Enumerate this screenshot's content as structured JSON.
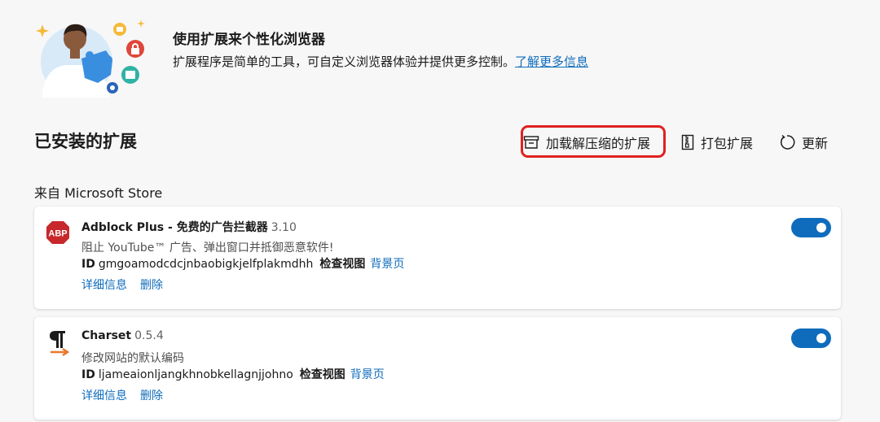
{
  "hero": {
    "title": "使用扩展来个性化浏览器",
    "description": "扩展程序是简单的工具，可自定义浏览器体验并提供更多控制。",
    "learn_more": "了解更多信息"
  },
  "section_title": "已安装的扩展",
  "toolbar": {
    "load_unpacked": "加载解压缩的扩展",
    "pack": "打包扩展",
    "update": "更新"
  },
  "store_label": "来自 Microsoft Store",
  "extensions": [
    {
      "name": "Adblock Plus - 免费的广告拦截器",
      "version": "3.10",
      "description": "阻止 YouTube™ 广告、弹出窗口并抵御恶意软件!",
      "id_label": "ID",
      "id": "gmgoamodcdcjnbaobigkjelfplakmdhh",
      "inspect_label": "检查视图",
      "background_page": "背景页",
      "details": "详细信息",
      "remove": "删除",
      "enabled": true,
      "icon": "abp-icon",
      "icon_text": "ABP"
    },
    {
      "name": "Charset",
      "version": "0.5.4",
      "description": "修改网站的默认编码",
      "id_label": "ID",
      "id": "ljameaionljangkhnobkellagnjjohno",
      "inspect_label": "检查视图",
      "background_page": "背景页",
      "details": "详细信息",
      "remove": "删除",
      "enabled": true,
      "icon": "charset-pilcrow-icon"
    }
  ],
  "colors": {
    "accent": "#0f6cbd",
    "highlight": "#e02020",
    "abp_red": "#c7282c",
    "charset_orange": "#e8782a"
  }
}
